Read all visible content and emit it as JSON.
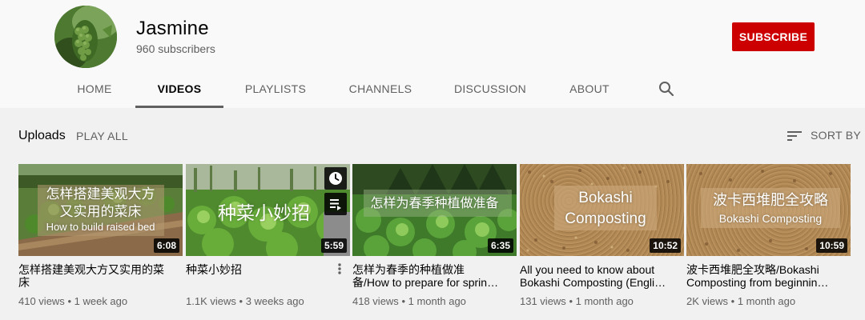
{
  "channel": {
    "name": "Jasmine",
    "subscribers": "960 subscribers",
    "subscribe_label": "SUBSCRIBE"
  },
  "tabs": [
    {
      "label": "HOME"
    },
    {
      "label": "VIDEOS",
      "active": true
    },
    {
      "label": "PLAYLISTS"
    },
    {
      "label": "CHANNELS"
    },
    {
      "label": "DISCUSSION"
    },
    {
      "label": "ABOUT"
    }
  ],
  "section": {
    "title": "Uploads",
    "play_all": "PLAY ALL",
    "sort_label": "SORT BY"
  },
  "videos": [
    {
      "overlay_line1": "怎样搭建美观大方",
      "overlay_line2": "又实用的菜床",
      "overlay_line3": "How to build raised bed",
      "duration": "6:08",
      "title": "怎样搭建美观大方又实用的菜床",
      "views": "410 views",
      "age": "1 week ago"
    },
    {
      "overlay_line1": "种菜小妙招",
      "duration": "5:59",
      "title": "种菜小妙招",
      "views": "1.1K views",
      "age": "3 weeks ago"
    },
    {
      "overlay_line1": "怎样为春季种植做准备",
      "duration": "6:35",
      "title": "怎样为春季的种植做准备/How to prepare for spring planting",
      "views": "418 views",
      "age": "1 month ago"
    },
    {
      "overlay_line1": "Bokashi",
      "overlay_line2": "Composting",
      "duration": "10:52",
      "title": "All you need to know about Bokashi Composting (English version)",
      "views": "131 views",
      "age": "1 month ago"
    },
    {
      "overlay_line1": "波卡西堆肥全攻略",
      "overlay_line2": "Bokashi Composting",
      "duration": "10:59",
      "title": "波卡西堆肥全攻略/Bokashi Composting from beginning to end",
      "views": "2K views",
      "age": "1 month ago"
    }
  ],
  "separator": "•",
  "icons": {
    "search": "search-icon",
    "sort": "sort-icon",
    "watch_later": "clock-icon",
    "add_to_queue": "queue-icon",
    "more": "more-vert-icon"
  },
  "colors": {
    "subscribe": "#cc0000",
    "background": "#f9f9f9",
    "content_background": "#f1f1f1",
    "secondary_text": "#606060"
  }
}
